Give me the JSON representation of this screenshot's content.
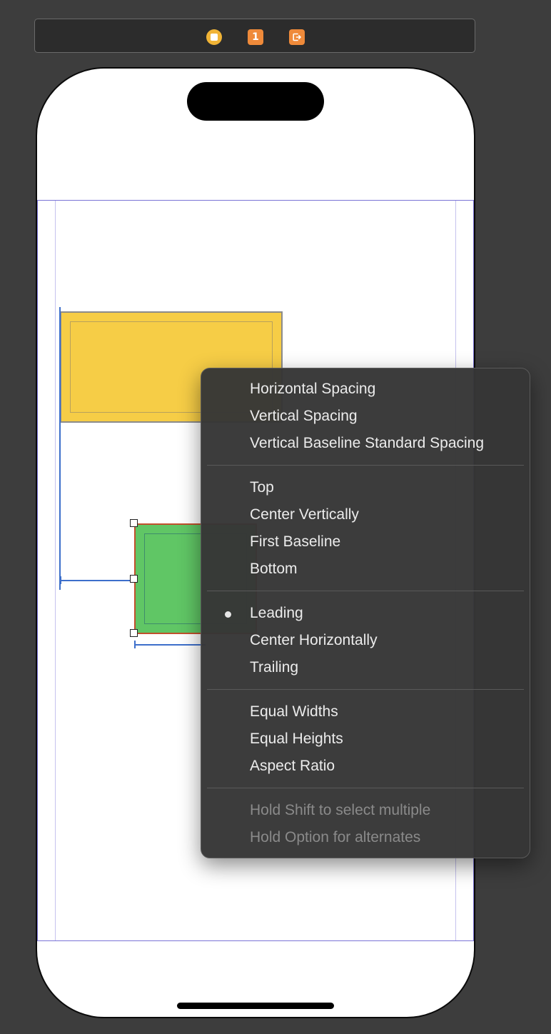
{
  "scene_dock": {
    "icons": [
      {
        "name": "view-controller-icon",
        "color": "#f1b436"
      },
      {
        "name": "first-responder-icon",
        "glyph": "1",
        "color": "#ef8a3a"
      },
      {
        "name": "exit-icon",
        "color": "#ef8a3a"
      }
    ]
  },
  "canvas": {
    "views": [
      {
        "name": "yellow-view",
        "color": "#f6cd46"
      },
      {
        "name": "green-view",
        "color": "#60c665",
        "selected": true
      }
    ]
  },
  "context_menu": {
    "spacing_items": [
      {
        "label": "Horizontal Spacing"
      },
      {
        "label": "Vertical Spacing"
      },
      {
        "label": "Vertical Baseline Standard Spacing"
      }
    ],
    "vertical_alignment_items": [
      {
        "label": "Top"
      },
      {
        "label": "Center Vertically"
      },
      {
        "label": "First Baseline"
      },
      {
        "label": "Bottom"
      }
    ],
    "horizontal_alignment_items": [
      {
        "label": "Leading",
        "checked": true
      },
      {
        "label": "Center Horizontally"
      },
      {
        "label": "Trailing"
      }
    ],
    "size_items": [
      {
        "label": "Equal Widths"
      },
      {
        "label": "Equal Heights"
      },
      {
        "label": "Aspect Ratio"
      }
    ],
    "hints": [
      {
        "label": "Hold Shift to select multiple"
      },
      {
        "label": "Hold Option for alternates"
      }
    ]
  }
}
